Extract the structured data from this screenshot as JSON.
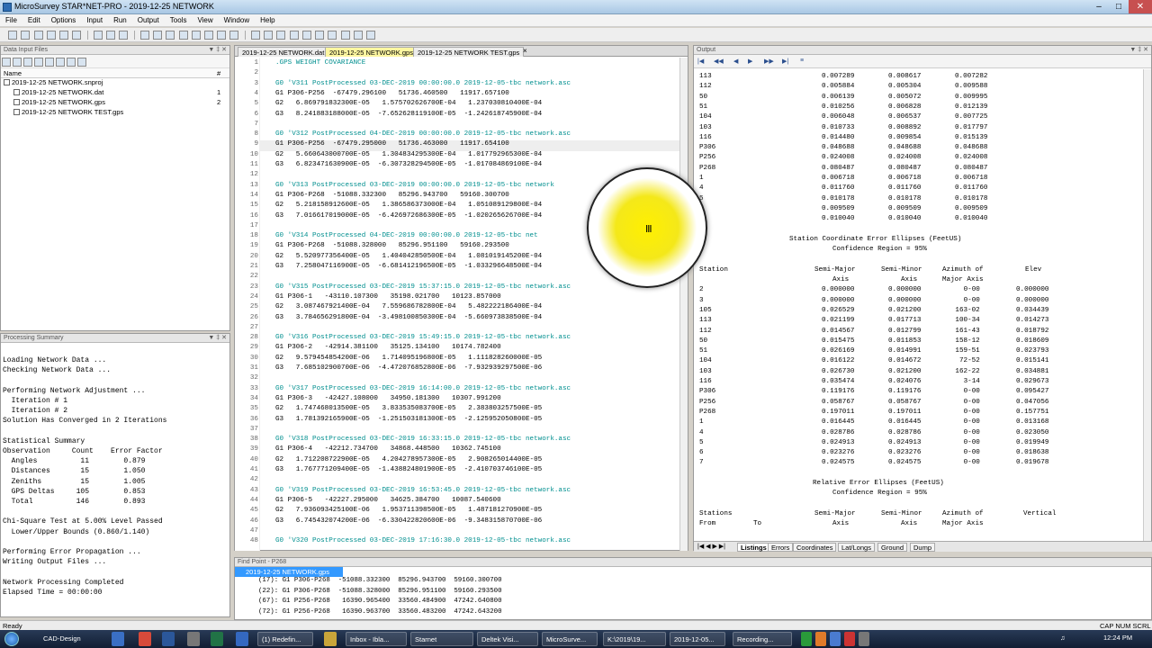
{
  "window": {
    "title": "MicroSurvey STAR*NET-PRO - 2019-12-25 NETWORK"
  },
  "menu": [
    "File",
    "Edit",
    "Options",
    "Input",
    "Run",
    "Output",
    "Tools",
    "View",
    "Window",
    "Help"
  ],
  "data_input": {
    "title": "Data Input Files",
    "col_name": "Name",
    "col_count": "#",
    "project": "2019-12-25 NETWORK.snproj",
    "files": [
      {
        "name": "2019-12-25 NETWORK.dat",
        "count": "1"
      },
      {
        "name": "2019-12-25 NETWORK.gps",
        "count": "2"
      },
      {
        "name": "2019-12-25 NETWORK TEST.gps",
        "count": ""
      }
    ]
  },
  "processing": {
    "title": "Processing Summary",
    "lines": [
      "",
      "Loading Network Data ...",
      "Checking Network Data ...",
      "",
      "Performing Network Adjustment ...",
      "  Iteration # 1",
      "  Iteration # 2",
      "Solution Has Converged in 2 Iterations",
      "",
      "Statistical Summary",
      "Observation     Count    Error Factor",
      "  Angles          11        0.879",
      "  Distances       15        1.050",
      "  Zeniths         15        1.005",
      "  GPS Deltas     105        0.853",
      "  Total          146        0.893",
      "",
      "Chi-Square Test at 5.00% Level Passed",
      "  Lower/Upper Bounds (0.860/1.140)",
      "",
      "Performing Error Propagation ...",
      "Writing Output Files ...",
      "",
      "Network Processing Completed",
      "Elapsed Time = 00:00:00"
    ]
  },
  "editor": {
    "tabs": [
      "2019-12-25 NETWORK.dat",
      "2019-12-25 NETWORK.gps",
      "2019-12-25 NETWORK TEST.gps"
    ],
    "active_tab": 1,
    "close_glyph": "×",
    "lines": [
      {
        "n": "1",
        "t": ".GPS WEIGHT COVARIANCE",
        "c": true
      },
      {
        "n": "2",
        "t": ""
      },
      {
        "n": "3",
        "t": "G0 'V311 PostProcessed 03-DEC-2019 00:00:00.0 2019-12-05-tbc network.asc",
        "c": true
      },
      {
        "n": "4",
        "t": "G1 P306-P256  -67479.296100   51736.460500   11917.657100"
      },
      {
        "n": "5",
        "t": "G2   6.869791832300E-05   1.575702626700E-04   1.237030810400E-04"
      },
      {
        "n": "6",
        "t": "G3   8.241883188000E-05  -7.652628119100E-05  -1.242618745900E-04"
      },
      {
        "n": "7",
        "t": ""
      },
      {
        "n": "8",
        "t": "G0 'V312 PostProcessed 04-DEC-2019 00:00:00.0 2019-12-05-tbc network.asc",
        "c": true
      },
      {
        "n": "9",
        "t": "G1 P306-P256  -67479.295000   51736.463000   11917.654100",
        "h": true
      },
      {
        "n": "10",
        "t": "G2   5.660643000700E-05   1.304834295300E-04   1.017792965300E-04"
      },
      {
        "n": "11",
        "t": "G3   6.823471630900E-05  -6.307328294500E-05  -1.017084869100E-04"
      },
      {
        "n": "12",
        "t": ""
      },
      {
        "n": "13",
        "t": "G0 'V313 PostProcessed 03-DEC-2019 00:00:00.0 2019-12-05-tbc network",
        "c": true
      },
      {
        "n": "14",
        "t": "G1 P306-P268  -51088.332300   85296.943700   59160.300700"
      },
      {
        "n": "15",
        "t": "G2   5.218158912600E-05   1.386586373000E-04   1.051089129800E-04"
      },
      {
        "n": "16",
        "t": "G3   7.016617019000E-05  -6.426972686300E-05  -1.020265626700E-04"
      },
      {
        "n": "17",
        "t": ""
      },
      {
        "n": "18",
        "t": "G0 'V314 PostProcessed 04-DEC-2019 00:00:00.0 2019-12-05-tbc net",
        "c": true
      },
      {
        "n": "19",
        "t": "G1 P306-P268  -51088.328000   85296.951100   59160.293500"
      },
      {
        "n": "20",
        "t": "G2   5.520977356400E-05   1.404042850500E-04   1.081019145200E-04"
      },
      {
        "n": "21",
        "t": "G3   7.258047116900E-05  -6.681412196500E-05  -1.033296648500E-04"
      },
      {
        "n": "22",
        "t": ""
      },
      {
        "n": "23",
        "t": "G0 'V315 PostProcessed 03-DEC-2019 15:37:15.0 2019-12-05-tbc network.asc",
        "c": true
      },
      {
        "n": "24",
        "t": "G1 P306-1   -43110.107300   35198.021700   10123.857000"
      },
      {
        "n": "25",
        "t": "G2   3.087467921400E-04   7.559686782800E-04   5.482222186400E-04"
      },
      {
        "n": "26",
        "t": "G3   3.784656291800E-04  -3.498100850300E-04  -5.660973838500E-04"
      },
      {
        "n": "27",
        "t": ""
      },
      {
        "n": "28",
        "t": "G0 'V316 PostProcessed 03-DEC-2019 15:49:15.0 2019-12-05-tbc network.asc",
        "c": true
      },
      {
        "n": "29",
        "t": "G1 P306-2   -42914.381100   35125.134100   10174.782400"
      },
      {
        "n": "30",
        "t": "G2   9.579454854200E-06   1.714095196800E-05   1.111828260000E-05"
      },
      {
        "n": "31",
        "t": "G3   7.685102900700E-06  -4.472076852800E-06  -7.932939297500E-06"
      },
      {
        "n": "32",
        "t": ""
      },
      {
        "n": "33",
        "t": "G0 'V317 PostProcessed 03-DEC-2019 16:14:00.0 2019-12-05-tbc network.asc",
        "c": true
      },
      {
        "n": "34",
        "t": "G1 P306-3   -42427.108000   34950.181300   10307.991200"
      },
      {
        "n": "35",
        "t": "G2   1.747468013500E-05   3.833535083700E-05   2.383803257500E-05"
      },
      {
        "n": "36",
        "t": "G3   1.781392165900E-05  -1.251503181300E-05  -2.125952050800E-05"
      },
      {
        "n": "37",
        "t": ""
      },
      {
        "n": "38",
        "t": "G0 'V318 PostProcessed 03-DEC-2019 16:33:15.0 2019-12-05-tbc network.asc",
        "c": true
      },
      {
        "n": "39",
        "t": "G1 P306-4   -42212.734700   34868.448500   10362.745100"
      },
      {
        "n": "40",
        "t": "G2   1.712208722900E-05   4.204278957300E-05   2.908265014400E-05"
      },
      {
        "n": "41",
        "t": "G3   1.767771209400E-05  -1.438824801900E-05  -2.410703746100E-05"
      },
      {
        "n": "42",
        "t": ""
      },
      {
        "n": "43",
        "t": "G0 'V319 PostProcessed 03-DEC-2019 16:53:45.0 2019-12-05-tbc network.asc",
        "c": true
      },
      {
        "n": "44",
        "t": "G1 P306-5   -42227.295000   34625.384700   10087.540600"
      },
      {
        "n": "45",
        "t": "G2   7.936093425100E-06   1.953711398500E-05   1.487181270900E-05"
      },
      {
        "n": "46",
        "t": "G3   6.745432074200E-06  -6.330422820600E-06  -9.348315870700E-06"
      },
      {
        "n": "47",
        "t": ""
      },
      {
        "n": "48",
        "t": "G0 'V320 PostProcessed 03-DEC-2019 17:16:30.0 2019-12-05-tbc network.asc",
        "c": true
      }
    ]
  },
  "output": {
    "title": "Output",
    "top_rows": [
      [
        "113",
        "0.007289",
        "0.008617",
        "0.007282"
      ],
      [
        "112",
        "0.005884",
        "0.005304",
        "0.009588"
      ],
      [
        "50",
        "0.006139",
        "0.005072",
        "0.009995"
      ],
      [
        "51",
        "0.010256",
        "0.006828",
        "0.012139"
      ],
      [
        "104",
        "0.006048",
        "0.006537",
        "0.007725"
      ],
      [
        "103",
        "0.010733",
        "0.008892",
        "0.017797"
      ],
      [
        "116",
        "0.014480",
        "0.009854",
        "0.015139"
      ],
      [
        "P306",
        "0.048688",
        "0.048688",
        "0.048688"
      ],
      [
        "P256",
        "0.024008",
        "0.024008",
        "0.024008"
      ],
      [
        "P268",
        "0.080487",
        "0.080487",
        "0.080487"
      ],
      [
        "1",
        "0.006718",
        "0.006718",
        "0.006718"
      ],
      [
        "4",
        "0.011760",
        "0.011760",
        "0.011760"
      ],
      [
        "5",
        "0.010178",
        "0.010178",
        "0.010178"
      ],
      [
        "6",
        "0.009509",
        "0.009509",
        "0.009509"
      ],
      [
        "7",
        "0.010040",
        "0.010040",
        "0.010040"
      ]
    ],
    "ellipse_title": "Station Coordinate Error Ellipses (FeetUS)",
    "confidence": "Confidence Region = 95%",
    "ellipse_headers": {
      "station": "Station",
      "semimajor1": "Semi-Major",
      "semimajor2": "Axis",
      "semiminor1": "Semi-Minor",
      "semiminor2": "Axis",
      "az1": "Azimuth of",
      "az2": "Major Axis",
      "elev": "Elev"
    },
    "ellipse_rows": [
      [
        "2",
        "0.000000",
        "0.000000",
        "0-00",
        "0.000000"
      ],
      [
        "3",
        "0.000000",
        "0.000000",
        "0-00",
        "0.000000"
      ],
      [
        "105",
        "0.026529",
        "0.021200",
        "163-02",
        "0.034439"
      ],
      [
        "113",
        "0.021199",
        "0.017713",
        "100-34",
        "0.014273"
      ],
      [
        "112",
        "0.014567",
        "0.012799",
        "161-43",
        "0.018792"
      ],
      [
        "50",
        "0.015475",
        "0.011853",
        "158-12",
        "0.018609"
      ],
      [
        "51",
        "0.026169",
        "0.014991",
        "159-51",
        "0.023793"
      ],
      [
        "104",
        "0.016122",
        "0.014672",
        "72-52",
        "0.015141"
      ],
      [
        "103",
        "0.026730",
        "0.021200",
        "162-22",
        "0.034881"
      ],
      [
        "116",
        "0.035474",
        "0.024076",
        "3-14",
        "0.029673"
      ],
      [
        "P306",
        "0.119176",
        "0.119176",
        "0-00",
        "0.095427"
      ],
      [
        "P256",
        "0.058767",
        "0.058767",
        "0-00",
        "0.047056"
      ],
      [
        "P268",
        "0.197011",
        "0.197011",
        "0-00",
        "0.157751"
      ],
      [
        "1",
        "0.016445",
        "0.016445",
        "0-00",
        "0.013168"
      ],
      [
        "4",
        "0.028786",
        "0.028786",
        "0-00",
        "0.023050"
      ],
      [
        "5",
        "0.024913",
        "0.024913",
        "0-00",
        "0.019949"
      ],
      [
        "6",
        "0.023276",
        "0.023276",
        "0-00",
        "0.018638"
      ],
      [
        "7",
        "0.024575",
        "0.024575",
        "0-00",
        "0.019678"
      ]
    ],
    "relative_title": "Relative Error Ellipses (FeetUS)",
    "relative_confidence": "Confidence Region = 95%",
    "relative_headers": {
      "stations": "Stations",
      "from": "From",
      "to": "To",
      "semimajor1": "Semi-Major",
      "semimajor2": "Axis",
      "semiminor1": "Semi-Minor",
      "semiminor2": "Axis",
      "az1": "Azimuth of",
      "az2": "Major Axis",
      "vertical": "Vertical"
    },
    "tabs": [
      "Listings",
      "Errors",
      "Coordinates",
      "Lat/Longs",
      "Ground",
      "Dump"
    ],
    "active_tab": 0
  },
  "find": {
    "title": "Find Point - P268",
    "file": "2019-12-25 NETWORK.gps",
    "results": [
      "(17): G1 P306-P268  -51088.332300  85296.943700  59160.300700",
      "(22): G1 P306-P268  -51088.328000  85296.951100  59160.293500",
      "(67): G1 P256-P268   16390.965400  33560.484900  47242.640800",
      "(72): G1 P256-P268   16390.963700  33560.483200  47242.643200"
    ]
  },
  "status": {
    "left": "Ready",
    "right": "CAP  NUM  SCRL"
  },
  "taskbar": {
    "items": [
      "CAD-Design",
      "(1) Redefin...",
      "Inbox - Ibla...",
      "Starnet",
      "Deltek Visi...",
      "MicroSurve...",
      "K:\\2019\\19...",
      "2019-12-05...",
      "Recording..."
    ],
    "clock": "12:24 PM"
  }
}
